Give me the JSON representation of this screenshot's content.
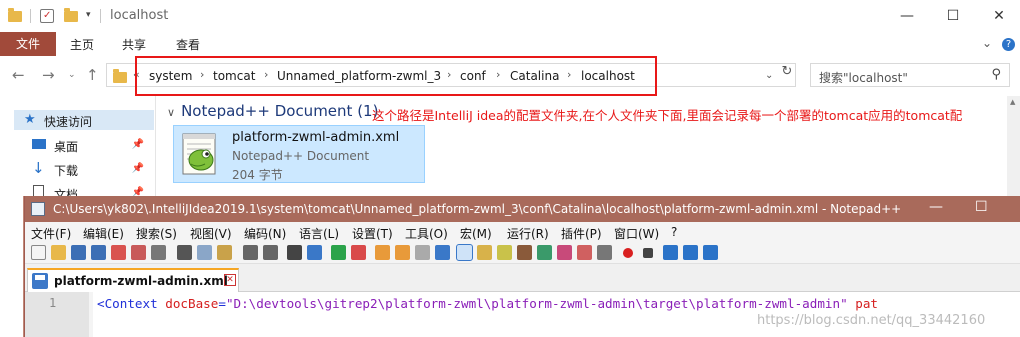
{
  "explorer": {
    "title": "localhost",
    "ribbon_tabs": [
      "文件",
      "主页",
      "共享",
      "查看"
    ],
    "breadcrumb": [
      "system",
      "tomcat",
      "Unnamed_platform-zwml_3",
      "conf",
      "Catalina",
      "localhost"
    ],
    "search_placeholder": "搜索\"localhost\"",
    "sidebar": [
      {
        "label": "快速访问"
      },
      {
        "label": "桌面"
      },
      {
        "label": "下载"
      },
      {
        "label": "文档"
      }
    ],
    "group_header": "Notepad++ Document (1)",
    "annotation": "这个路径是IntelliJ idea的配置文件夹,在个人文件夹下面,里面会记录每一个部署的tomcat应用的tomcat配置.",
    "file": {
      "name": "platform-zwml-admin.xml",
      "type": "Notepad++ Document",
      "size": "204 字节"
    }
  },
  "notepad": {
    "title": "C:\\Users\\yk802\\.IntelliJIdea2019.1\\system\\tomcat\\Unnamed_platform-zwml_3\\conf\\Catalina\\localhost\\platform-zwml-admin.xml - Notepad++",
    "menu": [
      "文件(F)",
      "编辑(E)",
      "搜索(S)",
      "视图(V)",
      "编码(N)",
      "语言(L)",
      "设置(T)",
      "工具(O)",
      "宏(M)",
      "运行(R)",
      "插件(P)",
      "窗口(W)",
      "?"
    ],
    "tab_label": "platform-zwml-admin.xml",
    "line_number": "1",
    "code": {
      "tag": "<Context",
      "attr": "docBase",
      "eq": "=",
      "value": "\"D:\\devtools\\gitrep2\\platform-zwml\\platform-zwml-admin\\target\\platform-zwml-admin\"",
      "next_attr": "pat"
    }
  },
  "watermark": "https://blog.csdn.net/qq_33442160"
}
